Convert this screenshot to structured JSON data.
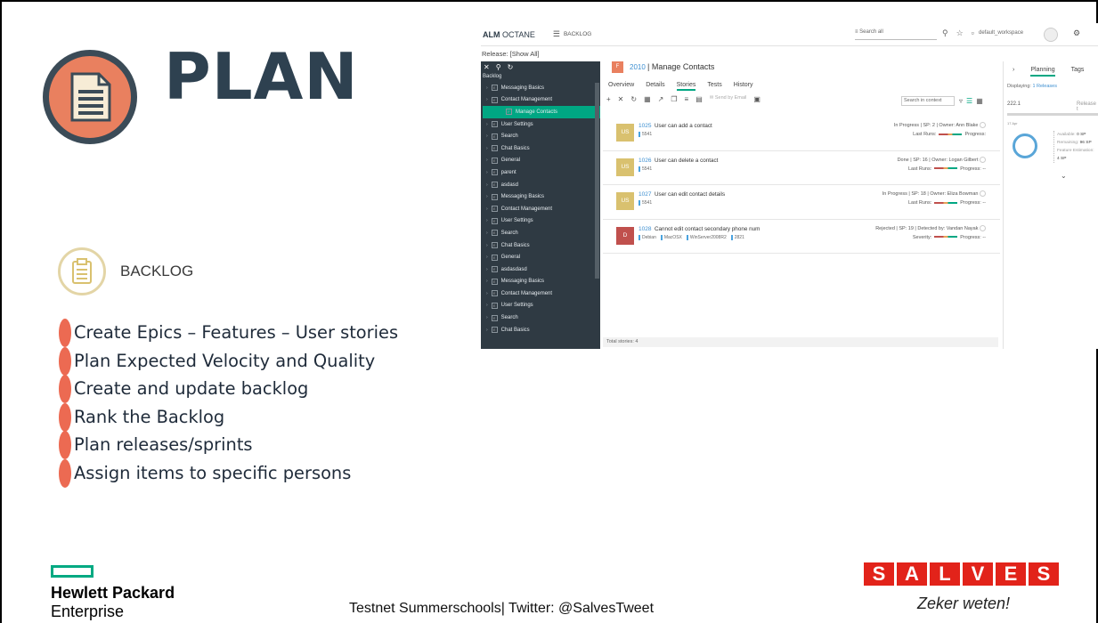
{
  "slide": {
    "title": "PLAN",
    "section_label": "BACKLOG",
    "bullets": [
      "Create Epics – Features – User stories",
      "Plan Expected Velocity and Quality",
      "Create and update backlog",
      "Rank the Backlog",
      "Plan releases/sprints",
      "Assign items to specific persons"
    ],
    "footer": {
      "hpe_name": "Hewlett Packard",
      "hpe_sub": "Enterprise",
      "center_text": "Testnet Summerschools| Twitter: @SalvesTweet",
      "salves_letters": [
        "S",
        "A",
        "L",
        "V",
        "E",
        "S"
      ],
      "salves_tagline": "Zeker weten!"
    },
    "colors": {
      "title": "#2e4150",
      "accent_orange": "#e9805f",
      "bullet_marker": "#ec6a52",
      "hpe_green": "#01a982",
      "salves_red": "#e2231a"
    }
  },
  "app": {
    "brand_bold": "ALM",
    "brand_thin": "OCTANE",
    "module": "BACKLOG",
    "search_placeholder": "Search all",
    "workspace": "default_workspace",
    "release_filter": "Release: [Show All]",
    "tree": {
      "root_label": "Backlog",
      "items": [
        {
          "label": "Messaging Basics",
          "type": "E"
        },
        {
          "label": "Contact Management",
          "type": "E"
        },
        {
          "label": "Manage Contacts",
          "type": "F",
          "selected": true
        },
        {
          "label": "User Settings",
          "type": "E"
        },
        {
          "label": "Search",
          "type": "E"
        },
        {
          "label": "Chat Basics",
          "type": "E"
        },
        {
          "label": "General",
          "type": "E"
        },
        {
          "label": "parent",
          "type": "E"
        },
        {
          "label": "asdasd",
          "type": "E"
        },
        {
          "label": "Messaging Basics",
          "type": "E"
        },
        {
          "label": "Contact Management",
          "type": "E"
        },
        {
          "label": "User Settings",
          "type": "E"
        },
        {
          "label": "Search",
          "type": "E"
        },
        {
          "label": "Chat Basics",
          "type": "E"
        },
        {
          "label": "General",
          "type": "E"
        },
        {
          "label": "asdasdasd",
          "type": "E"
        },
        {
          "label": "Messaging Basics",
          "type": "E"
        },
        {
          "label": "Contact Management",
          "type": "E"
        },
        {
          "label": "User Settings",
          "type": "E"
        },
        {
          "label": "Search",
          "type": "E"
        },
        {
          "label": "Chat Basics",
          "type": "E"
        }
      ]
    },
    "feature": {
      "badge": "F",
      "id": "2010",
      "title": "Manage Contacts",
      "tabs": [
        "Overview",
        "Details",
        "Stories",
        "Tests",
        "History"
      ],
      "active_tab": "Stories",
      "send_email": "Send by Email",
      "context_search": "Search in context",
      "stories": [
        {
          "tile": "US",
          "tile_color": "#d9c16f",
          "id": "1025",
          "title": "User can add a contact",
          "tags": [
            "5541"
          ],
          "meta1": "In Progress | SP: 2 | Owner: Ann Blake",
          "meta2_label": "Last Runs:",
          "meta2_progress": "Progress:"
        },
        {
          "tile": "US",
          "tile_color": "#d9c16f",
          "id": "1026",
          "title": "User can delete a contact",
          "tags": [
            "5541"
          ],
          "meta1": "Done | SP: 16 | Owner: Logan Gilbert",
          "meta2_label": "Last Runs:",
          "meta2_progress": "Progress: --"
        },
        {
          "tile": "US",
          "tile_color": "#d9c16f",
          "id": "1027",
          "title": "User can edit contact details",
          "tags": [
            "5541"
          ],
          "meta1": "In Progress | SP: 18 | Owner: Eliza Bowman",
          "meta2_label": "Last Runs:",
          "meta2_progress": "Progress: --"
        },
        {
          "tile": "D",
          "tile_color": "#c0504d",
          "id": "1028",
          "title": "Cannot edit contact secondary phone num",
          "tags": [
            "Debian",
            "MacOSX",
            "WinServer2008R2",
            "2821"
          ],
          "meta1": "Rejected | SP: 19 | Detected by: Vandan Nayak",
          "meta2_label": "Severity:",
          "meta2_progress": "Progress: --"
        }
      ],
      "total": "Total stories: 4"
    },
    "side_panel": {
      "tabs": [
        "Planning",
        "Tags"
      ],
      "displaying": "Displaying:",
      "displaying_link": "1 Releases",
      "release": "222.1",
      "release_suffix": "Release t",
      "date": "17 Apr",
      "stats": [
        {
          "k": "Available:",
          "v": "0 SP"
        },
        {
          "k": "Remaining:",
          "v": "96 SP"
        },
        {
          "k": "Feature Estimation:",
          "v": ""
        },
        {
          "k": "",
          "v": "4 SP"
        }
      ]
    }
  }
}
